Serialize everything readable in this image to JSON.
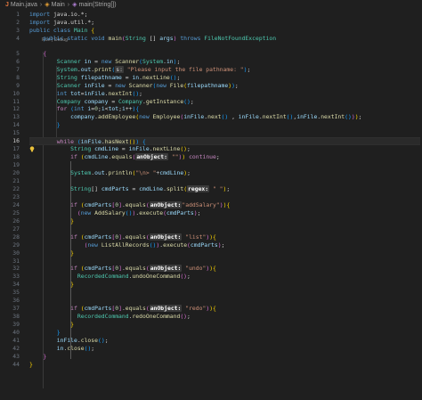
{
  "breadcrumb": {
    "file": "Main.java",
    "cls": "Main",
    "method": "main(String[])"
  },
  "codelens": "Run | Debug",
  "current_line": 16,
  "line_numbers": [
    "1",
    "2",
    "3",
    "4",
    "5",
    "6",
    "7",
    "8",
    "9",
    "10",
    "11",
    "12",
    "13",
    "14",
    "15",
    "16",
    "17",
    "18",
    "19",
    "20",
    "21",
    "22",
    "23",
    "24",
    "25",
    "26",
    "27",
    "28",
    "29",
    "30",
    "31",
    "32",
    "33",
    "34",
    "35",
    "36",
    "37",
    "38",
    "39",
    "40",
    "41",
    "42",
    "43",
    "44"
  ],
  "code_lines": [
    [
      [
        "kw",
        "import "
      ],
      [
        "pun",
        "java.io.*;"
      ]
    ],
    [
      [
        "kw",
        "import "
      ],
      [
        "pun",
        "java.util.*;"
      ]
    ],
    [
      [
        "kw",
        "public class "
      ],
      [
        "ty",
        "Main "
      ],
      [
        "br1",
        "{"
      ]
    ],
    [
      [
        "pun",
        "    "
      ],
      [
        "kw",
        "public static void "
      ],
      [
        "fn",
        "main"
      ],
      [
        "br2",
        "("
      ],
      [
        "ty",
        "String "
      ],
      [
        "pun",
        "[] "
      ],
      [
        "var",
        "args"
      ],
      [
        "br2",
        ")"
      ],
      [
        "kw",
        " throws "
      ],
      [
        "ty",
        "FileNotFoundException"
      ]
    ],
    [
      [
        "pun",
        "    "
      ],
      [
        "br2",
        "{"
      ]
    ],
    [
      [
        "pun",
        "        "
      ],
      [
        "ty",
        "Scanner "
      ],
      [
        "var",
        "in"
      ],
      [
        "pun",
        " = "
      ],
      [
        "kw",
        "new "
      ],
      [
        "fn",
        "Scanner"
      ],
      [
        "br3",
        "("
      ],
      [
        "ty",
        "System"
      ],
      [
        "pun",
        "."
      ],
      [
        "var",
        "in"
      ],
      [
        "br3",
        ")"
      ],
      [
        "pun",
        ";"
      ]
    ],
    [
      [
        "pun",
        "        "
      ],
      [
        "ty",
        "System"
      ],
      [
        "pun",
        "."
      ],
      [
        "var",
        "out"
      ],
      [
        "pun",
        "."
      ],
      [
        "fn",
        "print"
      ],
      [
        "br3",
        "("
      ],
      [
        "hint",
        "s:"
      ],
      [
        "str",
        " \"Please input the file pathname: \""
      ],
      [
        "br3",
        ")"
      ],
      [
        "pun",
        ";"
      ]
    ],
    [
      [
        "pun",
        "        "
      ],
      [
        "ty",
        "String "
      ],
      [
        "var",
        "filepathname"
      ],
      [
        "pun",
        " = "
      ],
      [
        "var",
        "in"
      ],
      [
        "pun",
        "."
      ],
      [
        "fn",
        "nextLine"
      ],
      [
        "br3",
        "()"
      ],
      [
        "pun",
        ";"
      ]
    ],
    [
      [
        "pun",
        "        "
      ],
      [
        "ty",
        "Scanner "
      ],
      [
        "var",
        "inFile"
      ],
      [
        "pun",
        " = "
      ],
      [
        "kw",
        "new "
      ],
      [
        "fn",
        "Scanner"
      ],
      [
        "br3",
        "("
      ],
      [
        "kw",
        "new "
      ],
      [
        "fn",
        "File"
      ],
      [
        "br1",
        "("
      ],
      [
        "var",
        "filepathname"
      ],
      [
        "br1",
        ")"
      ],
      [
        "br3",
        ")"
      ],
      [
        "pun",
        ";"
      ]
    ],
    [
      [
        "pun",
        "        "
      ],
      [
        "kw",
        "int "
      ],
      [
        "var",
        "tot"
      ],
      [
        "pun",
        "="
      ],
      [
        "var",
        "inFile"
      ],
      [
        "pun",
        "."
      ],
      [
        "fn",
        "nextInt"
      ],
      [
        "br3",
        "()"
      ],
      [
        "pun",
        ";"
      ]
    ],
    [
      [
        "pun",
        "        "
      ],
      [
        "ty",
        "Company "
      ],
      [
        "var",
        "company"
      ],
      [
        "pun",
        " = "
      ],
      [
        "ty",
        "Company"
      ],
      [
        "pun",
        "."
      ],
      [
        "fn",
        "getInstance"
      ],
      [
        "br3",
        "()"
      ],
      [
        "pun",
        ";"
      ]
    ],
    [
      [
        "pun",
        "        "
      ],
      [
        "ctl",
        "for "
      ],
      [
        "br3",
        "("
      ],
      [
        "kw",
        "int "
      ],
      [
        "var",
        "i"
      ],
      [
        "pun",
        "="
      ],
      [
        "num",
        "0"
      ],
      [
        "pun",
        ";"
      ],
      [
        "var",
        "i"
      ],
      [
        "pun",
        "<"
      ],
      [
        "var",
        "tot"
      ],
      [
        "pun",
        ";"
      ],
      [
        "var",
        "i"
      ],
      [
        "pun",
        "++"
      ],
      [
        "br3",
        ")"
      ],
      [
        "br3",
        "{"
      ]
    ],
    [
      [
        "pun",
        "            "
      ],
      [
        "var",
        "company"
      ],
      [
        "pun",
        "."
      ],
      [
        "fn",
        "addEmployee"
      ],
      [
        "br1",
        "("
      ],
      [
        "kw",
        "new "
      ],
      [
        "fn",
        "Employee"
      ],
      [
        "br2",
        "("
      ],
      [
        "var",
        "inFile"
      ],
      [
        "pun",
        "."
      ],
      [
        "fn",
        "next"
      ],
      [
        "br3",
        "()"
      ],
      [
        "pun",
        " , "
      ],
      [
        "var",
        "inFile"
      ],
      [
        "pun",
        "."
      ],
      [
        "fn",
        "nextInt"
      ],
      [
        "br3",
        "()"
      ],
      [
        "pun",
        ","
      ],
      [
        "var",
        "inFile"
      ],
      [
        "pun",
        "."
      ],
      [
        "fn",
        "nextInt"
      ],
      [
        "br3",
        "()"
      ],
      [
        "br2",
        ")"
      ],
      [
        "br1",
        ")"
      ],
      [
        "pun",
        ";"
      ]
    ],
    [
      [
        "pun",
        "        "
      ],
      [
        "br3",
        "}"
      ]
    ],
    [],
    [
      [
        "pun",
        "        "
      ],
      [
        "ctl",
        "while "
      ],
      [
        "br3",
        "("
      ],
      [
        "var",
        "inFile"
      ],
      [
        "pun",
        "."
      ],
      [
        "fn",
        "hasNext"
      ],
      [
        "br1",
        "()"
      ],
      [
        "br3",
        ")"
      ],
      [
        "pun",
        " "
      ],
      [
        "br3",
        "{"
      ]
    ],
    [
      [
        "pun",
        "            "
      ],
      [
        "ty",
        "String "
      ],
      [
        "var",
        "cmdLine"
      ],
      [
        "pun",
        " = "
      ],
      [
        "var",
        "inFile"
      ],
      [
        "pun",
        "."
      ],
      [
        "fn",
        "nextLine"
      ],
      [
        "br1",
        "()"
      ],
      [
        "pun",
        ";"
      ]
    ],
    [
      [
        "pun",
        "            "
      ],
      [
        "ctl",
        "if "
      ],
      [
        "br1",
        "("
      ],
      [
        "var",
        "cmdLine"
      ],
      [
        "pun",
        "."
      ],
      [
        "fn",
        "equals"
      ],
      [
        "br2",
        "("
      ],
      [
        "hintb",
        "anObject:"
      ],
      [
        "str",
        " \"\""
      ],
      [
        "br2",
        ")"
      ],
      [
        "br1",
        ")"
      ],
      [
        "ctl",
        " continue"
      ],
      [
        "pun",
        ";"
      ]
    ],
    [],
    [
      [
        "pun",
        "            "
      ],
      [
        "ty",
        "System"
      ],
      [
        "pun",
        "."
      ],
      [
        "var",
        "out"
      ],
      [
        "pun",
        "."
      ],
      [
        "fn",
        "println"
      ],
      [
        "br1",
        "("
      ],
      [
        "str",
        "\"\\n> \""
      ],
      [
        "pun",
        "+"
      ],
      [
        "var",
        "cmdLine"
      ],
      [
        "br1",
        ")"
      ],
      [
        "pun",
        ";"
      ]
    ],
    [],
    [
      [
        "pun",
        "            "
      ],
      [
        "ty",
        "String"
      ],
      [
        "pun",
        "[] "
      ],
      [
        "var",
        "cmdParts"
      ],
      [
        "pun",
        " = "
      ],
      [
        "var",
        "cmdLine"
      ],
      [
        "pun",
        "."
      ],
      [
        "fn",
        "split"
      ],
      [
        "br1",
        "("
      ],
      [
        "hintb",
        "regex:"
      ],
      [
        "str",
        " \" \""
      ],
      [
        "br1",
        ")"
      ],
      [
        "pun",
        ";"
      ]
    ],
    [],
    [
      [
        "pun",
        "            "
      ],
      [
        "ctl",
        "if "
      ],
      [
        "br1",
        "("
      ],
      [
        "var",
        "cmdParts"
      ],
      [
        "br2",
        "["
      ],
      [
        "num",
        "0"
      ],
      [
        "br2",
        "]"
      ],
      [
        "pun",
        "."
      ],
      [
        "fn",
        "equals"
      ],
      [
        "br2",
        "("
      ],
      [
        "hintb",
        "anObject:"
      ],
      [
        "str",
        "\"addSalary\""
      ],
      [
        "br2",
        ")"
      ],
      [
        "br1",
        ")"
      ],
      [
        "br1",
        "{"
      ]
    ],
    [
      [
        "pun",
        "              "
      ],
      [
        "br2",
        "("
      ],
      [
        "kw",
        "new "
      ],
      [
        "fn",
        "AddSalary"
      ],
      [
        "br3",
        "()"
      ],
      [
        "br2",
        ")"
      ],
      [
        "pun",
        "."
      ],
      [
        "fn",
        "execute"
      ],
      [
        "br2",
        "("
      ],
      [
        "var",
        "cmdParts"
      ],
      [
        "br2",
        ")"
      ],
      [
        "pun",
        ";"
      ]
    ],
    [
      [
        "pun",
        "            "
      ],
      [
        "br1",
        "}"
      ]
    ],
    [],
    [
      [
        "pun",
        "            "
      ],
      [
        "ctl",
        "if "
      ],
      [
        "br1",
        "("
      ],
      [
        "var",
        "cmdParts"
      ],
      [
        "br2",
        "["
      ],
      [
        "num",
        "0"
      ],
      [
        "br2",
        "]"
      ],
      [
        "pun",
        "."
      ],
      [
        "fn",
        "equals"
      ],
      [
        "br2",
        "("
      ],
      [
        "hintb",
        "anObject:"
      ],
      [
        "str",
        " \"list\""
      ],
      [
        "br2",
        ")"
      ],
      [
        "br1",
        ")"
      ],
      [
        "br1",
        "{"
      ]
    ],
    [
      [
        "pun",
        "                "
      ],
      [
        "br2",
        "("
      ],
      [
        "kw",
        "new "
      ],
      [
        "fn",
        "ListAllRecords"
      ],
      [
        "br3",
        "()"
      ],
      [
        "br2",
        ")"
      ],
      [
        "pun",
        "."
      ],
      [
        "fn",
        "execute"
      ],
      [
        "br2",
        "("
      ],
      [
        "var",
        "cmdParts"
      ],
      [
        "br2",
        ")"
      ],
      [
        "pun",
        ";"
      ]
    ],
    [
      [
        "pun",
        "            "
      ],
      [
        "br1",
        "}"
      ]
    ],
    [],
    [
      [
        "pun",
        "            "
      ],
      [
        "ctl",
        "if "
      ],
      [
        "br1",
        "("
      ],
      [
        "var",
        "cmdParts"
      ],
      [
        "br2",
        "["
      ],
      [
        "num",
        "0"
      ],
      [
        "br2",
        "]"
      ],
      [
        "pun",
        "."
      ],
      [
        "fn",
        "equals"
      ],
      [
        "br2",
        "("
      ],
      [
        "hintb",
        "anObject:"
      ],
      [
        "str",
        " \"undo\""
      ],
      [
        "br2",
        ")"
      ],
      [
        "br1",
        ")"
      ],
      [
        "br1",
        "{"
      ]
    ],
    [
      [
        "pun",
        "              "
      ],
      [
        "ty",
        "RecordedCommand"
      ],
      [
        "pun",
        "."
      ],
      [
        "fn",
        "undoOneCommand"
      ],
      [
        "br2",
        "()"
      ],
      [
        "pun",
        ";"
      ]
    ],
    [
      [
        "pun",
        "            "
      ],
      [
        "br1",
        "}"
      ]
    ],
    [],
    [],
    [
      [
        "pun",
        "            "
      ],
      [
        "ctl",
        "if "
      ],
      [
        "br1",
        "("
      ],
      [
        "var",
        "cmdParts"
      ],
      [
        "br2",
        "["
      ],
      [
        "num",
        "0"
      ],
      [
        "br2",
        "]"
      ],
      [
        "pun",
        "."
      ],
      [
        "fn",
        "equals"
      ],
      [
        "br2",
        "("
      ],
      [
        "hintb",
        "anObject:"
      ],
      [
        "str",
        " \"redo\""
      ],
      [
        "br2",
        ")"
      ],
      [
        "br1",
        ")"
      ],
      [
        "br1",
        "{"
      ]
    ],
    [
      [
        "pun",
        "              "
      ],
      [
        "ty",
        "RecordedCommand"
      ],
      [
        "pun",
        "."
      ],
      [
        "fn",
        "redoOneCommand"
      ],
      [
        "br2",
        "()"
      ],
      [
        "pun",
        ";"
      ]
    ],
    [
      [
        "pun",
        "            "
      ],
      [
        "br1",
        "}"
      ]
    ],
    [
      [
        "pun",
        "        "
      ],
      [
        "br3",
        "}"
      ]
    ],
    [
      [
        "pun",
        "        "
      ],
      [
        "var",
        "inFile"
      ],
      [
        "pun",
        "."
      ],
      [
        "fn",
        "close"
      ],
      [
        "br3",
        "()"
      ],
      [
        "pun",
        ";"
      ]
    ],
    [
      [
        "pun",
        "        "
      ],
      [
        "var",
        "in"
      ],
      [
        "pun",
        "."
      ],
      [
        "fn",
        "close"
      ],
      [
        "br3",
        "()"
      ],
      [
        "pun",
        ";"
      ]
    ],
    [
      [
        "pun",
        "    "
      ],
      [
        "br2",
        "}"
      ]
    ],
    [
      [
        "br1",
        "}"
      ]
    ]
  ]
}
